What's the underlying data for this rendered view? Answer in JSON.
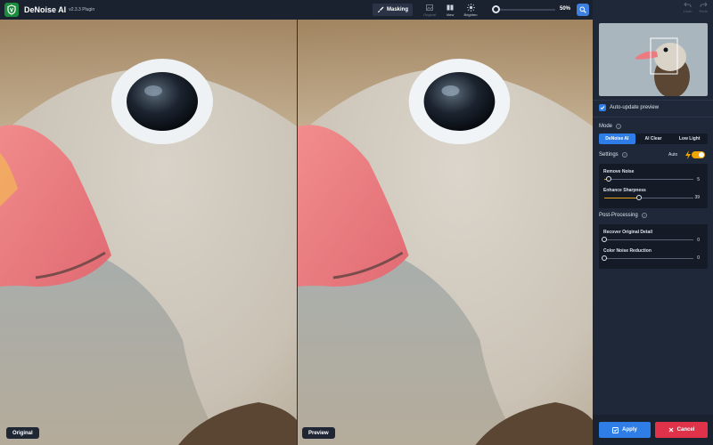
{
  "app": {
    "title": "DeNoise AI",
    "version": "v2.3.3 Plugin",
    "logo_icon": "shield-logo-icon",
    "brand_color": "#1c8b3e"
  },
  "toolbar": {
    "masking_label": "Masking",
    "original_label": "Original",
    "view_label": "View",
    "brighten_label": "Brighten",
    "zoom_level": "50%",
    "zoom_fraction": 0.05,
    "undo_label": "Undo",
    "redo_label": "Redo"
  },
  "panels": {
    "left_label": "Original",
    "right_label": "Preview"
  },
  "side": {
    "auto_update_label": "Auto-update preview",
    "auto_update_checked": true,
    "mode_title": "Mode",
    "modes": [
      "DeNoise AI",
      "AI Clear",
      "Low Light"
    ],
    "active_mode": "DeNoise AI",
    "settings_title": "Settings",
    "auto_label": "Auto",
    "auto_on": true,
    "settings": [
      {
        "label": "Remove Noise",
        "value": "5",
        "fraction": 0.05
      },
      {
        "label": "Enhance Sharpness",
        "value": "39",
        "fraction": 0.39
      }
    ],
    "post_title": "Post-Processing",
    "post": [
      {
        "label": "Recover Original Detail",
        "value": "0",
        "fraction": 0.0
      },
      {
        "label": "Color Noise Reduction",
        "value": "0",
        "fraction": 0.0
      }
    ],
    "apply_label": "Apply",
    "cancel_label": "Cancel"
  },
  "colors": {
    "accent": "#2f7de6",
    "slider_fill": "#e8a416",
    "cancel": "#e0334a",
    "panel_bg": "#1e2839"
  }
}
